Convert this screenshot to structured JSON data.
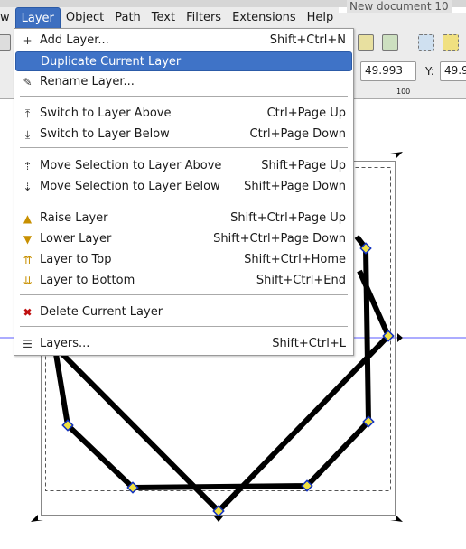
{
  "window": {
    "title": "New document 10"
  },
  "menubar": [
    "w",
    "Layer",
    "Object",
    "Path",
    "Text",
    "Filters",
    "Extensions",
    "Help"
  ],
  "toolbar": {
    "x_value": "49.993",
    "y_label": "Y:",
    "y_value": "49.9",
    "ruler_label": "100"
  },
  "menu": {
    "items": [
      {
        "label": "Add Layer...",
        "shortcut": "Shift+Ctrl+N",
        "icon": "add-layer-icon"
      },
      {
        "label": "Duplicate Current Layer",
        "shortcut": "",
        "icon": "",
        "highlighted": true
      },
      {
        "label": "Rename Layer...",
        "shortcut": "",
        "icon": "rename-layer-icon"
      },
      {
        "label": "Switch to Layer Above",
        "shortcut": "Ctrl+Page Up",
        "icon": "switch-layer-above-icon"
      },
      {
        "label": "Switch to Layer Below",
        "shortcut": "Ctrl+Page Down",
        "icon": "switch-layer-below-icon"
      },
      {
        "label": "Move Selection to Layer Above",
        "shortcut": "Shift+Page Up",
        "icon": "move-selection-above-icon"
      },
      {
        "label": "Move Selection to Layer Below",
        "shortcut": "Shift+Page Down",
        "icon": "move-selection-below-icon"
      },
      {
        "label": "Raise Layer",
        "shortcut": "Shift+Ctrl+Page Up",
        "icon": "raise-layer-icon"
      },
      {
        "label": "Lower Layer",
        "shortcut": "Shift+Ctrl+Page Down",
        "icon": "lower-layer-icon"
      },
      {
        "label": "Layer to Top",
        "shortcut": "Shift+Ctrl+Home",
        "icon": "layer-to-top-icon"
      },
      {
        "label": "Layer to Bottom",
        "shortcut": "Shift+Ctrl+End",
        "icon": "layer-to-bottom-icon"
      },
      {
        "label": "Delete Current Layer",
        "shortcut": "",
        "icon": "delete-layer-icon"
      },
      {
        "label": "Layers...",
        "shortcut": "Shift+Ctrl+L",
        "icon": "layers-icon"
      }
    ]
  },
  "colors": {
    "highlight": "#3f73c7",
    "guide": "#4040ff",
    "node": "#f0e040"
  }
}
